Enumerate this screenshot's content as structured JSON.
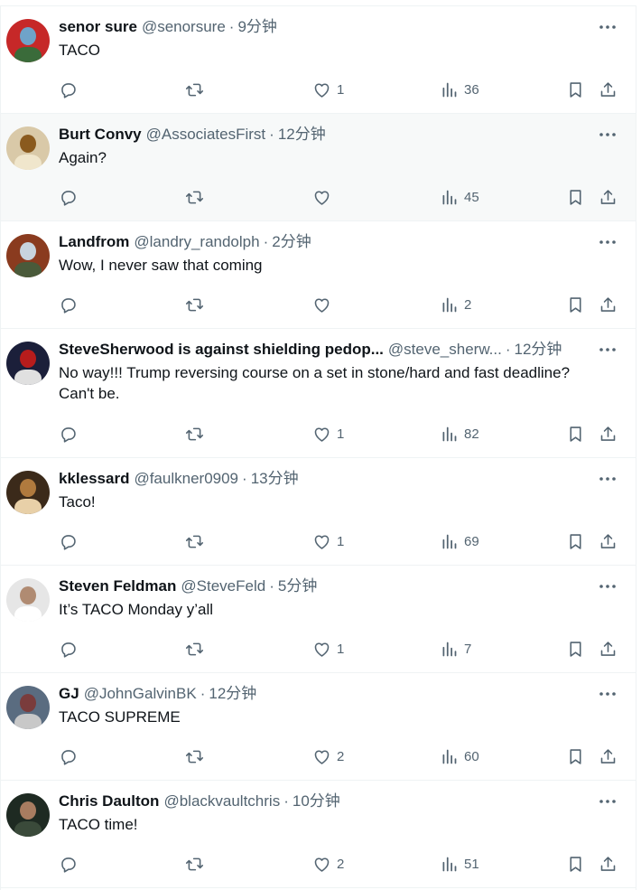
{
  "tweets": [
    {
      "name": "senor sure",
      "handle": "@senorsure",
      "time": "9分钟",
      "text": "TACO",
      "likes": "1",
      "views": "36",
      "highlight": false,
      "avatar_colors": [
        "#c62828",
        "#6fa3c9",
        "#3a6b3a"
      ]
    },
    {
      "name": "Burt Convy",
      "handle": "@AssociatesFirst",
      "time": "12分钟",
      "text": "Again?",
      "likes": "",
      "views": "45",
      "highlight": true,
      "avatar_colors": [
        "#d9c9a8",
        "#8a5a1e",
        "#f0e6cc"
      ]
    },
    {
      "name": "Landfrom",
      "handle": "@landry_randolph",
      "time": "2分钟",
      "text": "Wow, I never saw that coming",
      "likes": "",
      "views": "2",
      "highlight": false,
      "avatar_colors": [
        "#8a3b1f",
        "#c8d4de",
        "#4a5a3a"
      ]
    },
    {
      "name": "SteveSherwood is against shielding pedop...",
      "handle": "@steve_sherw...",
      "time": "12分钟",
      "text": "No way!!! Trump reversing course on a set in stone/hard and fast deadline? Can't be.",
      "likes": "1",
      "views": "82",
      "highlight": false,
      "avatar_colors": [
        "#1b1f3a",
        "#b71c1c",
        "#e0e0e0"
      ]
    },
    {
      "name": "kklessard",
      "handle": "@faulkner0909",
      "time": "13分钟",
      "text": "Taco!",
      "likes": "1",
      "views": "69",
      "highlight": false,
      "avatar_colors": [
        "#3b2a1a",
        "#b07a3e",
        "#e8d0a8"
      ]
    },
    {
      "name": "Steven Feldman",
      "handle": "@SteveFeld",
      "time": "5分钟",
      "text": "It’s TACO Monday y’all",
      "likes": "1",
      "views": "7",
      "highlight": false,
      "avatar_colors": [
        "#e6e6e6",
        "#b08b72",
        "#ffffff"
      ]
    },
    {
      "name": "GJ",
      "handle": "@JohnGalvinBK",
      "time": "12分钟",
      "text": "TACO SUPREME",
      "likes": "2",
      "views": "60",
      "highlight": false,
      "avatar_colors": [
        "#5a6c80",
        "#7a3c3c",
        "#c8c8c8"
      ]
    },
    {
      "name": "Chris Daulton",
      "handle": "@blackvaultchris",
      "time": "10分钟",
      "text": "TACO time!",
      "likes": "2",
      "views": "51",
      "highlight": false,
      "avatar_colors": [
        "#1e2a22",
        "#a87c60",
        "#3a4a3a"
      ]
    }
  ],
  "icons": {
    "more": "more-icon",
    "reply": "reply-icon",
    "retweet": "retweet-icon",
    "like": "heart-icon",
    "views": "views-icon",
    "bookmark": "bookmark-icon",
    "share": "share-icon"
  },
  "colors": {
    "text": "#0f1419",
    "secondary": "#536471",
    "border": "#eff3f4",
    "highlight_bg": "#f7f9f9"
  }
}
